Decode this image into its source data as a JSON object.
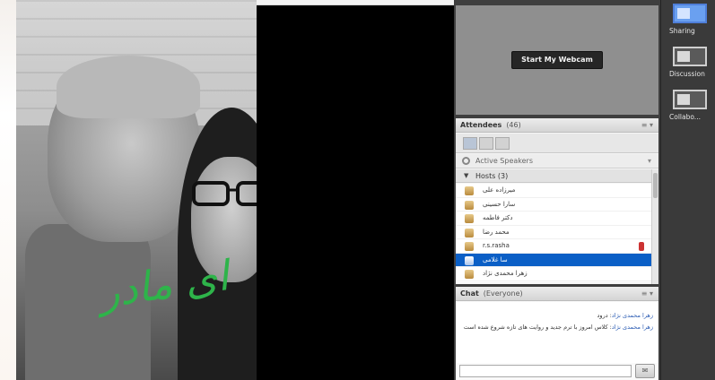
{
  "share": {
    "caption": "ای مادر"
  },
  "webcam": {
    "start_label": "Start My Webcam"
  },
  "attendees": {
    "title": "Attendees",
    "count": "(46)",
    "active_speakers": "Active Speakers",
    "host_group": "Hosts (3)",
    "rows": [
      {
        "name": "میرزاده علی",
        "selected": false,
        "mic": false
      },
      {
        "name": "سارا حسینی",
        "selected": false,
        "mic": false
      },
      {
        "name": "دکتر فاطمه",
        "selected": false,
        "mic": false
      },
      {
        "name": "محمد رضا",
        "selected": false,
        "mic": false
      },
      {
        "name": "r.s.rasha",
        "selected": false,
        "mic": true
      },
      {
        "name": "سا غلامی",
        "selected": true,
        "mic": false
      },
      {
        "name": "زهرا محمدی نژاد",
        "selected": false,
        "mic": false
      }
    ]
  },
  "chat": {
    "title": "Chat",
    "scope": "(Everyone)",
    "messages": [
      {
        "sender": "زهرا محمدی نژاد",
        "text": "درود"
      },
      {
        "sender": "زهرا محمدی نژاد",
        "text": "کلاس امروز با ترم جدید و روایت های تازه شروع شده است"
      }
    ],
    "send_icon": "speech-bubble-icon"
  },
  "layouts": [
    {
      "label": "Sharing",
      "active": true
    },
    {
      "label": "Discussion",
      "active": false
    },
    {
      "label": "Collabo...",
      "active": false
    }
  ],
  "colors": {
    "selected_row": "#0b5fc6",
    "caption_green": "#2eb44a",
    "active_layout": "#4f7fd9"
  }
}
